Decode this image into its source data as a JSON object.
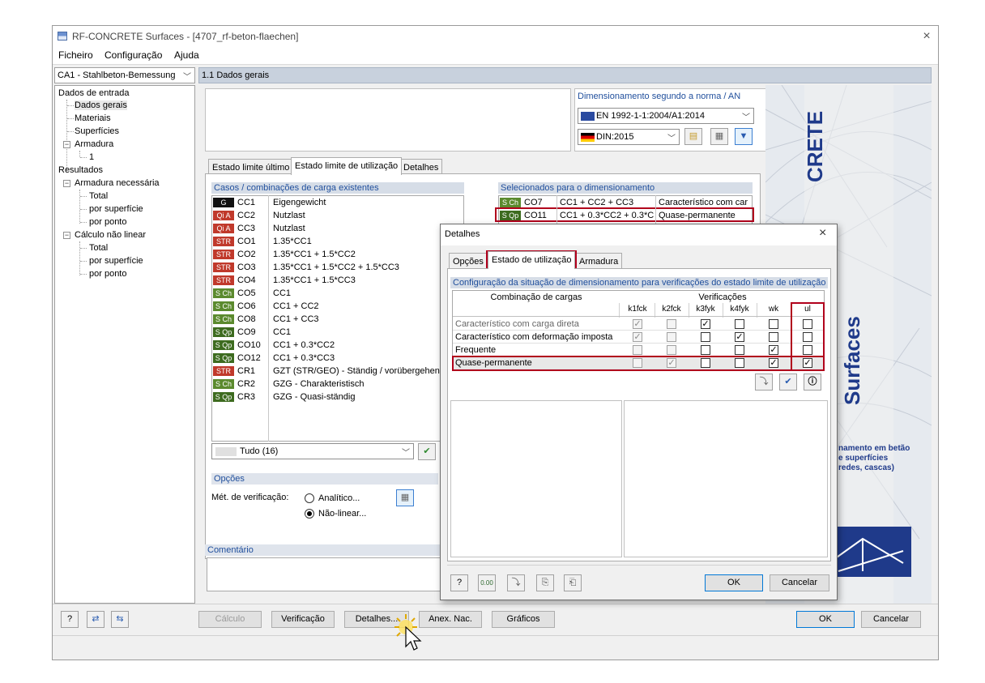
{
  "window": {
    "title": "RF-CONCRETE Surfaces - [4707_rf-beton-flaechen]",
    "close": "×"
  },
  "menu": [
    "Ficheiro",
    "Configuração",
    "Ajuda"
  ],
  "case_select": "CA1 - Stahlbeton-Bemessung",
  "tree": {
    "input_root": "Dados de entrada",
    "input_items": [
      "Dados gerais",
      "Materiais",
      "Superfícies",
      "Armadura",
      "1"
    ],
    "results_root": "Resultados",
    "required": "Armadura necessária",
    "required_items": [
      "Total",
      "por superfície",
      "por ponto"
    ],
    "nonlinear": "Cálculo não linear",
    "nonlinear_items": [
      "Total",
      "por superfície",
      "por ponto"
    ]
  },
  "panel_title": "1.1 Dados gerais",
  "norm": {
    "title": "Dimensionamento segundo a norma / AN",
    "standard": "EN 1992-1-1:2004/A1:2014",
    "annex": "DIN:2015"
  },
  "main_tabs": [
    "Estado limite último",
    "Estado limite de utilização",
    "Detalhes"
  ],
  "lc_group_title": "Casos / combinações de carga existentes",
  "load_cases": [
    {
      "badge": "G",
      "color": "#111111",
      "id": "CC1",
      "name": "Eigengewicht"
    },
    {
      "badge": "Qi A",
      "color": "#c0392b",
      "id": "CC2",
      "name": "Nutzlast"
    },
    {
      "badge": "Qi A",
      "color": "#c0392b",
      "id": "CC3",
      "name": "Nutzlast"
    },
    {
      "badge": "STR",
      "color": "#c0392b",
      "id": "CO1",
      "name": "1.35*CC1"
    },
    {
      "badge": "STR",
      "color": "#c0392b",
      "id": "CO2",
      "name": "1.35*CC1 + 1.5*CC2"
    },
    {
      "badge": "STR",
      "color": "#c0392b",
      "id": "CO3",
      "name": "1.35*CC1 + 1.5*CC2 + 1.5*CC3"
    },
    {
      "badge": "STR",
      "color": "#c0392b",
      "id": "CO4",
      "name": "1.35*CC1 + 1.5*CC3"
    },
    {
      "badge": "S Ch",
      "color": "#5b8a2e",
      "id": "CO5",
      "name": "CC1"
    },
    {
      "badge": "S Ch",
      "color": "#5b8a2e",
      "id": "CO6",
      "name": "CC1 + CC2"
    },
    {
      "badge": "S Ch",
      "color": "#5b8a2e",
      "id": "CO8",
      "name": "CC1 + CC3"
    },
    {
      "badge": "S Qp",
      "color": "#3d6b1f",
      "id": "CO9",
      "name": "CC1"
    },
    {
      "badge": "S Qp",
      "color": "#3d6b1f",
      "id": "CO10",
      "name": "CC1 + 0.3*CC2"
    },
    {
      "badge": "S Qp",
      "color": "#3d6b1f",
      "id": "CO12",
      "name": "CC1 + 0.3*CC3"
    },
    {
      "badge": "STR",
      "color": "#c0392b",
      "id": "CR1",
      "name": "GZT (STR/GEO) - Ständig / vorübergehend"
    },
    {
      "badge": "S Ch",
      "color": "#5b8a2e",
      "id": "CR2",
      "name": "GZG - Charakteristisch"
    },
    {
      "badge": "S Qp",
      "color": "#3d6b1f",
      "id": "CR3",
      "name": "GZG - Quasi-ständig"
    }
  ],
  "filter_value": "Tudo (16)",
  "sel_group_title": "Selecionados para o dimensionamento",
  "selected": [
    {
      "badge": "S Ch",
      "color": "#5b8a2e",
      "id": "CO7",
      "formula": "CC1 + CC2 + CC3",
      "type": "Característico com car"
    },
    {
      "badge": "S Qp",
      "color": "#3d6b1f",
      "id": "CO11",
      "formula": "CC1 + 0.3*CC2 + 0.3*C",
      "type": "Quase-permanente"
    }
  ],
  "options": {
    "title": "Opções",
    "method_label": "Mét. de verificação:",
    "analytic": "Analítico...",
    "nonlinear": "Não-linear..."
  },
  "comment_title": "Comentário",
  "bottom_buttons": [
    "Cálculo",
    "Verificação",
    "Detalhes...",
    "Anex. Nac.",
    "Gráficos"
  ],
  "ok": "OK",
  "cancel": "Cancelar",
  "product": {
    "name_part1": "CRETE",
    "name_part2": "Surfaces",
    "desc_lines": [
      "namento em betão",
      "e superfícies",
      "redes, cascas)"
    ]
  },
  "dialog": {
    "title": "Detalhes",
    "tabs": [
      "Opções",
      "Estado de utilização",
      "Armadura"
    ],
    "group_title": "Configuração da situação de dimensionamento para verificações do estado limite de utilização",
    "col_combination": "Combinação de cargas",
    "col_checks": "Verificações",
    "col_heads": [
      "k1fck",
      "k2fck",
      "k3fyk",
      "k4fyk",
      "wk",
      "ul"
    ],
    "rows": [
      {
        "name": "Característico com carga direta",
        "checks": [
          1,
          0,
          1,
          0,
          0,
          0
        ],
        "disabled": [
          1,
          1,
          0,
          0,
          0,
          0
        ]
      },
      {
        "name": "Característico com deformação imposta",
        "checks": [
          1,
          0,
          0,
          1,
          0,
          0
        ],
        "disabled": [
          1,
          1,
          0,
          0,
          0,
          0
        ]
      },
      {
        "name": "Frequente",
        "checks": [
          0,
          0,
          0,
          0,
          1,
          0
        ],
        "disabled": [
          1,
          1,
          0,
          0,
          0,
          0
        ]
      },
      {
        "name": "Quase-permanente",
        "checks": [
          0,
          1,
          0,
          0,
          1,
          1
        ],
        "disabled": [
          1,
          1,
          0,
          0,
          0,
          0
        ]
      }
    ]
  }
}
